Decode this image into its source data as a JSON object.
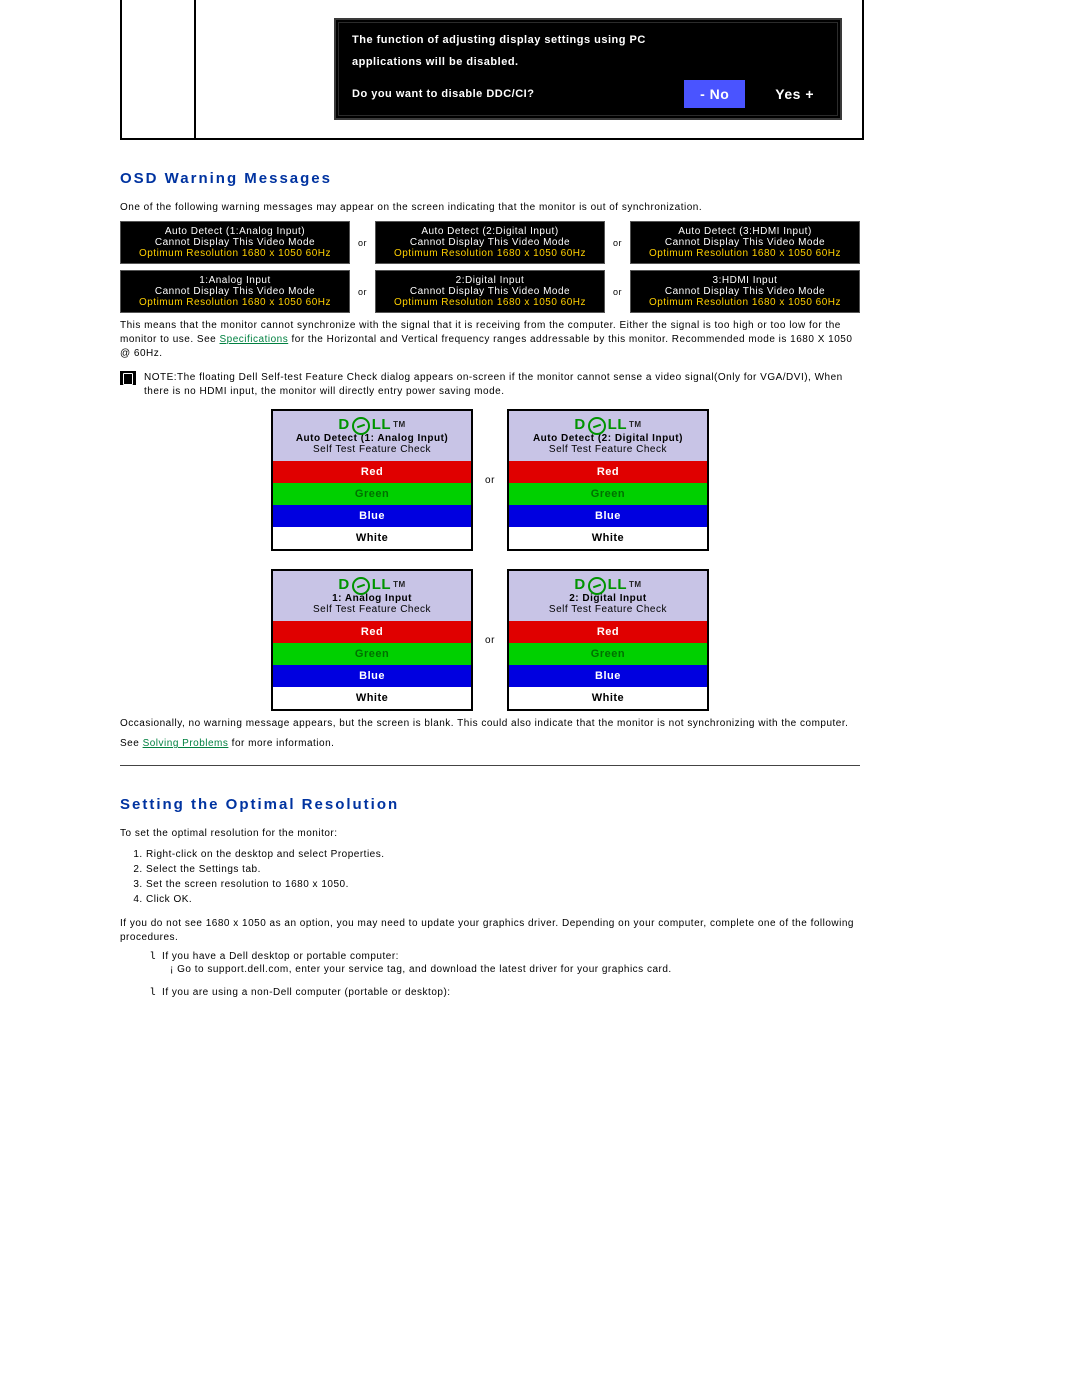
{
  "ddc": {
    "line1": "The function of adjusting display settings using PC",
    "line2": "applications will be disabled.",
    "question": "Do you want to disable DDC/CI?",
    "no": "- No",
    "yes": "Yes +"
  },
  "headings": {
    "osd": "OSD Warning Messages",
    "optimal": "Setting the Optimal Resolution"
  },
  "osd_intro": "One of the following warning messages may appear on the screen indicating that the monitor is out of synchronization.",
  "or": "or",
  "warn_row1": [
    {
      "l1": "Auto Detect (1:Analog Input)",
      "l2": "Cannot Display This Video Mode",
      "l3": "Optimum Resolution 1680 x 1050 60Hz"
    },
    {
      "l1": "Auto Detect (2:Digital Input)",
      "l2": "Cannot Display This Video Mode",
      "l3": "Optimum Resolution 1680 x 1050 60Hz"
    },
    {
      "l1": "Auto Detect (3:HDMI Input)",
      "l2": "Cannot Display This Video Mode",
      "l3": "Optimum Resolution 1680 x 1050 60Hz"
    }
  ],
  "warn_row2": [
    {
      "l1": "1:Analog Input",
      "l2": "Cannot Display This Video Mode",
      "l3": "Optimum Resolution 1680 x 1050 60Hz"
    },
    {
      "l1": "2:Digital Input",
      "l2": "Cannot Display This Video Mode",
      "l3": "Optimum Resolution 1680 x 1050 60Hz"
    },
    {
      "l1": "3:HDMI Input",
      "l2": "Cannot Display This Video Mode",
      "l3": "Optimum Resolution 1680 x 1050 60Hz"
    }
  ],
  "osd_explain": {
    "pre": "This means that the monitor cannot synchronize with the signal that it is receiving from the computer. Either the signal is too high or too low for the monitor to use.  See ",
    "link": "Specifications",
    "post": " for the Horizontal and Vertical frequency ranges addressable by this monitor. Recommended mode is 1680 X 1050 @ 60Hz."
  },
  "note": "NOTE:The floating Dell Self-test Feature Check dialog appears on-screen if the monitor cannot sense a video signal(Only for VGA/DVI),  When there is no HDMI input, the monitor will directly entry power saving mode.",
  "selftest": {
    "brand_pre": "D",
    "brand_post": "LL",
    "tm": "TM",
    "feature": "Self Test  Feature Check",
    "red": "Red",
    "green": "Green",
    "blue": "Blue",
    "white": "White",
    "titles": [
      "Auto Detect (1: Analog Input)",
      "Auto Detect (2: Digital Input)",
      "1: Analog Input",
      "2: Digital Input"
    ]
  },
  "osd_occasionally": "Occasionally, no warning message appears, but the screen is blank. This could also indicate that the monitor is not synchronizing with the computer.",
  "osd_see": {
    "pre": "See ",
    "link": "Solving Problems",
    "post": " for more information."
  },
  "optimal_intro": "To set the optimal resolution for the monitor:",
  "optimal_steps": [
    "Right-click on the desktop and select Properties.",
    "Select the Settings tab.",
    "Set the screen resolution to 1680 x 1050.",
    "Click OK."
  ],
  "optimal_after": "If you do not see 1680 x 1050 as an option, you may need to update your graphics driver. Depending on your computer, complete one of the following procedures.",
  "optimal_bullets": {
    "a_lead": "If you have a Dell desktop or portable computer:",
    "a_sub": "Go to support.dell.com, enter your service tag, and download the latest driver for your graphics card.",
    "b_lead": "If you are using a non-Dell computer (portable or desktop):"
  }
}
